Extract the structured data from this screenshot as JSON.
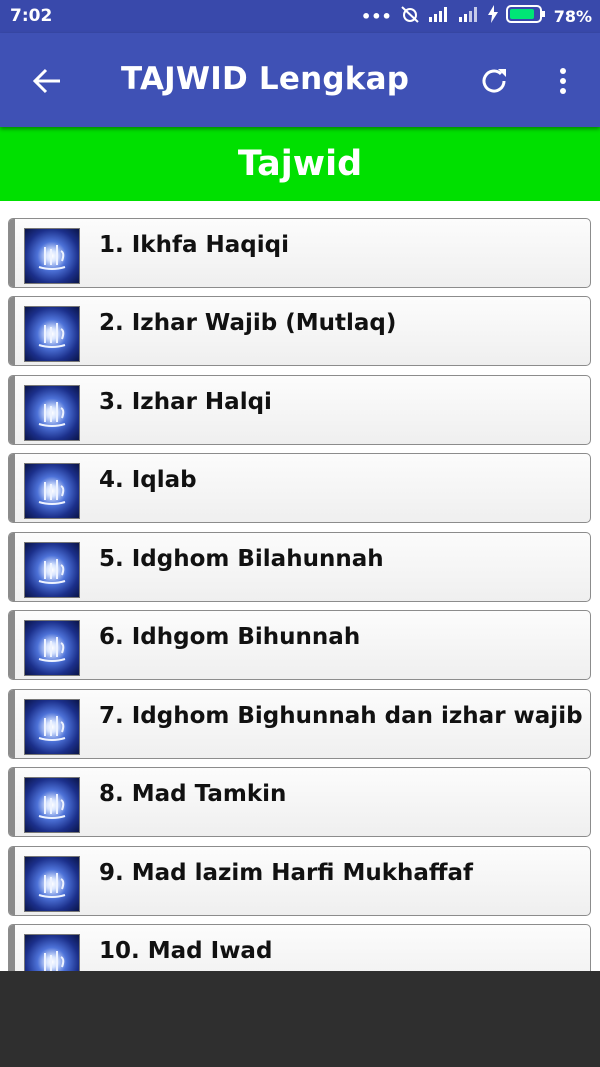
{
  "status_bar": {
    "time": "7:02",
    "battery": "78%"
  },
  "app_bar": {
    "title": "TAJWID Lengkap"
  },
  "header": {
    "title": "Tajwid"
  },
  "items": [
    {
      "label": "1. Ikhfa Haqiqi"
    },
    {
      "label": "2. Izhar Wajib (Mutlaq)"
    },
    {
      "label": "3. Izhar Halqi"
    },
    {
      "label": "4. Iqlab"
    },
    {
      "label": "5. Idghom Bilahunnah"
    },
    {
      "label": "6. Idhgom Bihunnah"
    },
    {
      "label": "7. Idghom Bighunnah dan izhar wajib"
    },
    {
      "label": "8. Mad Tamkin"
    },
    {
      "label": "9. Mad lazim Harfi Mukhaffaf"
    },
    {
      "label": "10. Mad Iwad"
    }
  ],
  "colors": {
    "status_bar": "#3949ab",
    "app_bar": "#3f51b5",
    "header_band": "#00e000",
    "nav_bar": "#2f2f2f"
  },
  "icons": {
    "back": "arrow-back-icon",
    "refresh": "refresh-icon",
    "more": "more-vert-icon",
    "item": "allah-calligraphy-icon"
  }
}
